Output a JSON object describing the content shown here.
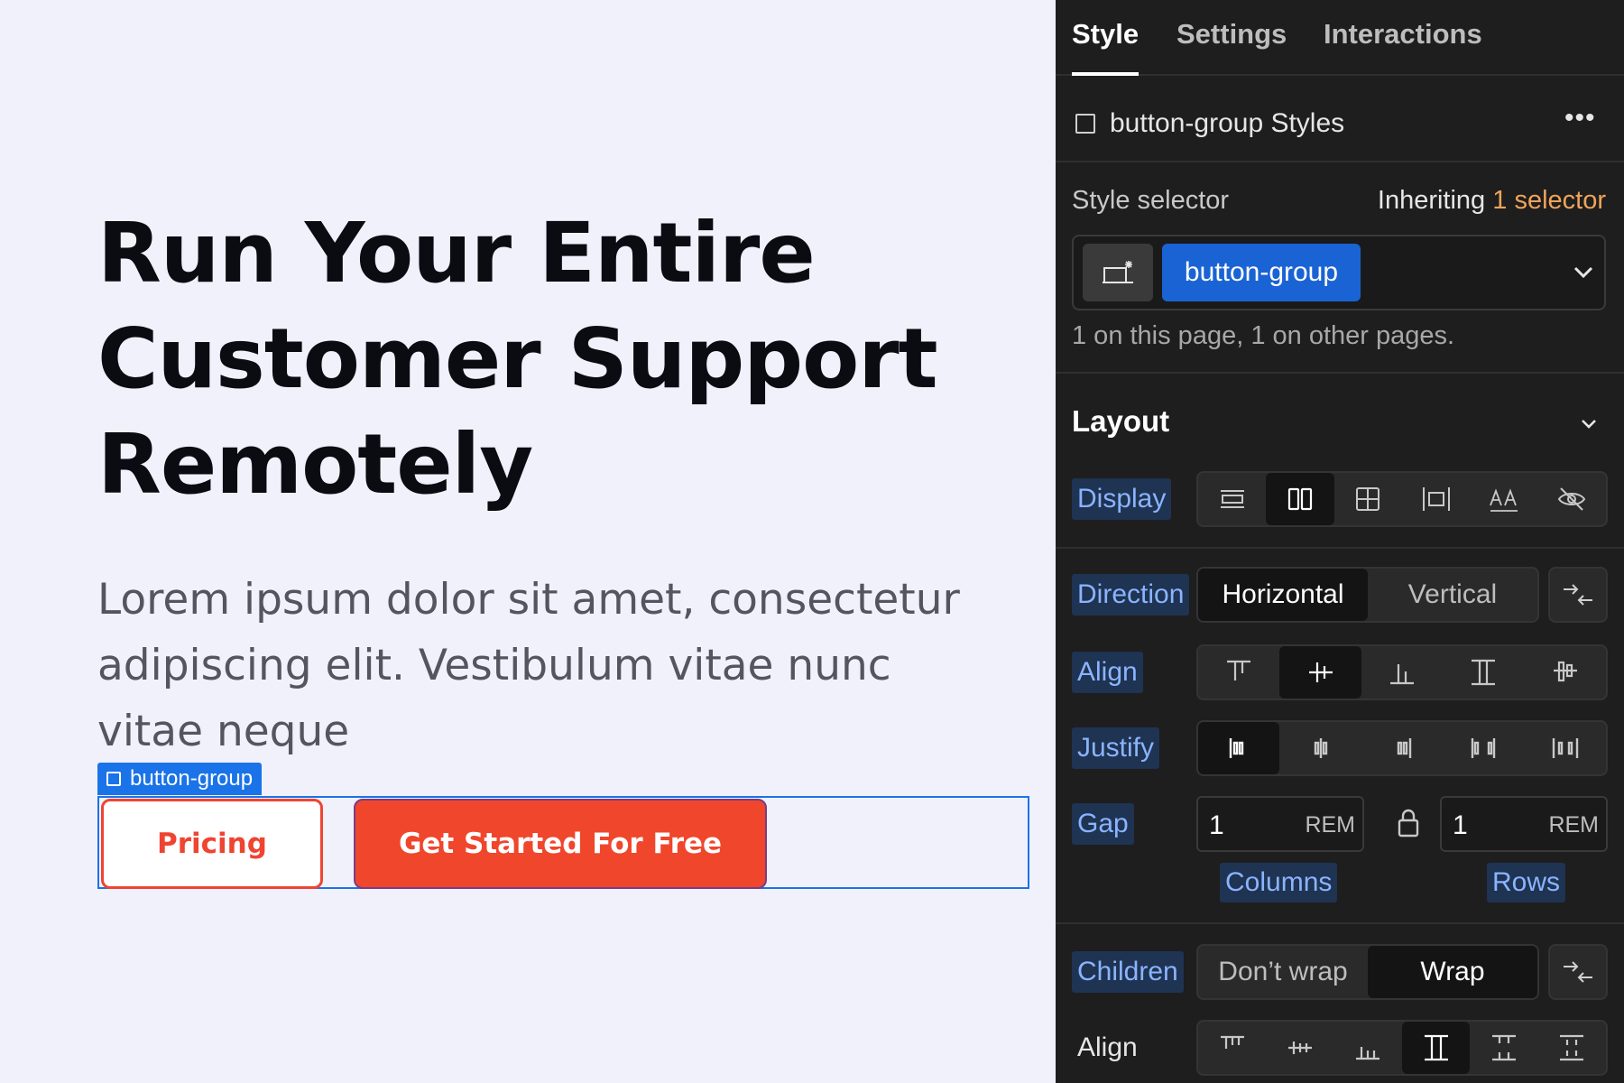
{
  "canvas": {
    "title_lines": [
      "Run Your Entire",
      "Customer Support",
      "Remotely"
    ],
    "description": "Lorem ipsum dolor sit amet, consectetur adipiscing elit. Vestibulum vitae nunc vitae neque",
    "selection_tag": "button-group",
    "buttons": {
      "pricing": "Pricing",
      "get_started": "Get Started For Free"
    },
    "colors": {
      "accent": "#f0462c",
      "selection": "#1a73e8"
    }
  },
  "panel": {
    "tabs": [
      "Style",
      "Settings",
      "Interactions"
    ],
    "active_tab": "Style",
    "styles_header": "button-group Styles",
    "style_selector": {
      "label": "Style selector",
      "inheriting_prefix": "Inheriting",
      "inheriting_link": "1 selector",
      "chip": "button-group",
      "usage": "1 on this page, 1 on other pages."
    },
    "layout": {
      "title": "Layout",
      "display_label": "Display",
      "display_options": [
        "block-icon",
        "flex-icon",
        "grid-icon",
        "inline-block-icon",
        "inline-text-icon",
        "hidden-icon"
      ],
      "display_selected": "flex-icon",
      "direction_label": "Direction",
      "direction_options": [
        "Horizontal",
        "Vertical"
      ],
      "direction_selected": "Horizontal",
      "align_label": "Align",
      "align_selected_index": 1,
      "justify_label": "Justify",
      "justify_selected_index": 0,
      "gap_label": "Gap",
      "gap_columns": {
        "value": "1",
        "unit": "REM",
        "label": "Columns"
      },
      "gap_rows": {
        "value": "1",
        "unit": "REM",
        "label": "Rows"
      },
      "children_label": "Children",
      "children_options": [
        "Don’t wrap",
        "Wrap"
      ],
      "children_selected": "Wrap",
      "content_align_label": "Align",
      "content_align_selected_index": 3
    },
    "colors": {
      "panel_bg": "#1e1e1e",
      "chip": "#1a63d4",
      "highlight": "#f0a45a",
      "label_blue": "#8ab4ff"
    }
  }
}
